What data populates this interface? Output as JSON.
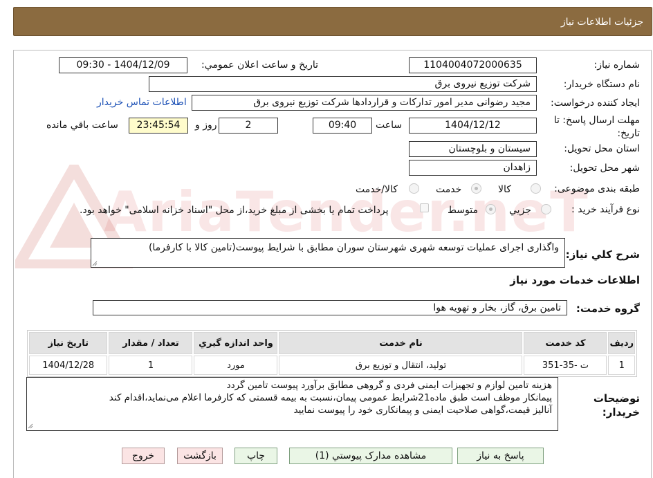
{
  "header": {
    "title": "جزئیات اطلاعات نیاز"
  },
  "form": {
    "need_number_label": "شماره نیاز:",
    "need_number": "1104004072000635",
    "announce_label": "تاریخ و ساعت اعلان عمومي:",
    "announce_value": "1404/12/09 - 09:30",
    "buyer_org_label": "نام دستگاه خريدار:",
    "buyer_org": "شرکت توزیع نیروی برق",
    "requester_label": "ايجاد کننده درخواست:",
    "requester": "مجید  رضوانی مدیر امور تدارکات و قراردادها شرکت توزیع نیروی برق",
    "contact_link": "اطلاعات تماس خريدار",
    "deadline_label": "مهلت ارسال پاسخ: تا تاریخ:",
    "deadline_date": "1404/12/12",
    "time_label": "ساعت",
    "deadline_time": "09:40",
    "days": "2",
    "days_label": "روز و",
    "remaining": "23:45:54",
    "remaining_label": "ساعت باقي مانده",
    "province_label": "استان محل تحویل:",
    "province": "سیستان و بلوچستان",
    "city_label": "شهر محل تحویل:",
    "city": "زاهدان",
    "category_label": "طبقه بندی موضوعی:",
    "category_options": [
      "کالا",
      "خدمت",
      "کالا/خدمت"
    ],
    "category_selected": "خدمت",
    "process_label": "نوع فرآیند خرید :",
    "process_options": [
      "جزيي",
      "متوسط"
    ],
    "process_selected": "متوسط",
    "payment_note": "پرداخت تمام یا بخشی از مبلغ خرید،از محل \"اسناد خزانه اسلامی\" خواهد بود.",
    "description_label": "شرح کلي نياز:",
    "description": "واگذاری اجرای عملیات توسعه شهری شهرستان سوران مطابق با شرایط پیوست(تامین کالا با کارفرما)"
  },
  "services": {
    "section_title": "اطلاعات خدمات مورد نياز",
    "group_label": "گروه خدمت:",
    "group_value": "تامین برق، گاز، بخار و تهویه هوا",
    "columns": [
      "رديف",
      "کد خدمت",
      "نام خدمت",
      "واحد اندازه گيري",
      "تعداد / مقدار",
      "تاريخ نياز"
    ],
    "rows": [
      [
        "1",
        "ت -35-351",
        "تولید، انتقال و توزیع برق",
        "مورد",
        "1",
        "1404/12/28"
      ]
    ]
  },
  "buyer_notes": {
    "label": "توضيحات خريدار:",
    "lines": [
      "هزینه تامین لوازم و تجهیزات ایمنی فردی و گروهی مطابق برآورد پیوست تامین گردد",
      "پیمانکار موظف است طبق ماده21شرایط عمومی پیمان،نسبت به بیمه قسمتی که کارفرما اعلام می‌نماید،اقدام کند",
      "آنالیز قیمت،گواهی صلاحیت ایمنی و پیمانکاری خود را پیوست نمایید"
    ]
  },
  "buttons": {
    "reply": "پاسخ به نياز",
    "attachments": "مشاهده مدارک پيوستي (1)",
    "print": "چاپ",
    "back": "بازگشت",
    "exit": "خروج"
  },
  "watermark": {
    "text": "AriaTender.neT"
  },
  "colors": {
    "header_bg": "#8b6b40",
    "link": "#1a4fb5",
    "button_bg": "#eaf6e6",
    "button_pink": "#fbe4e4",
    "timer_bg": "#fffccc"
  }
}
